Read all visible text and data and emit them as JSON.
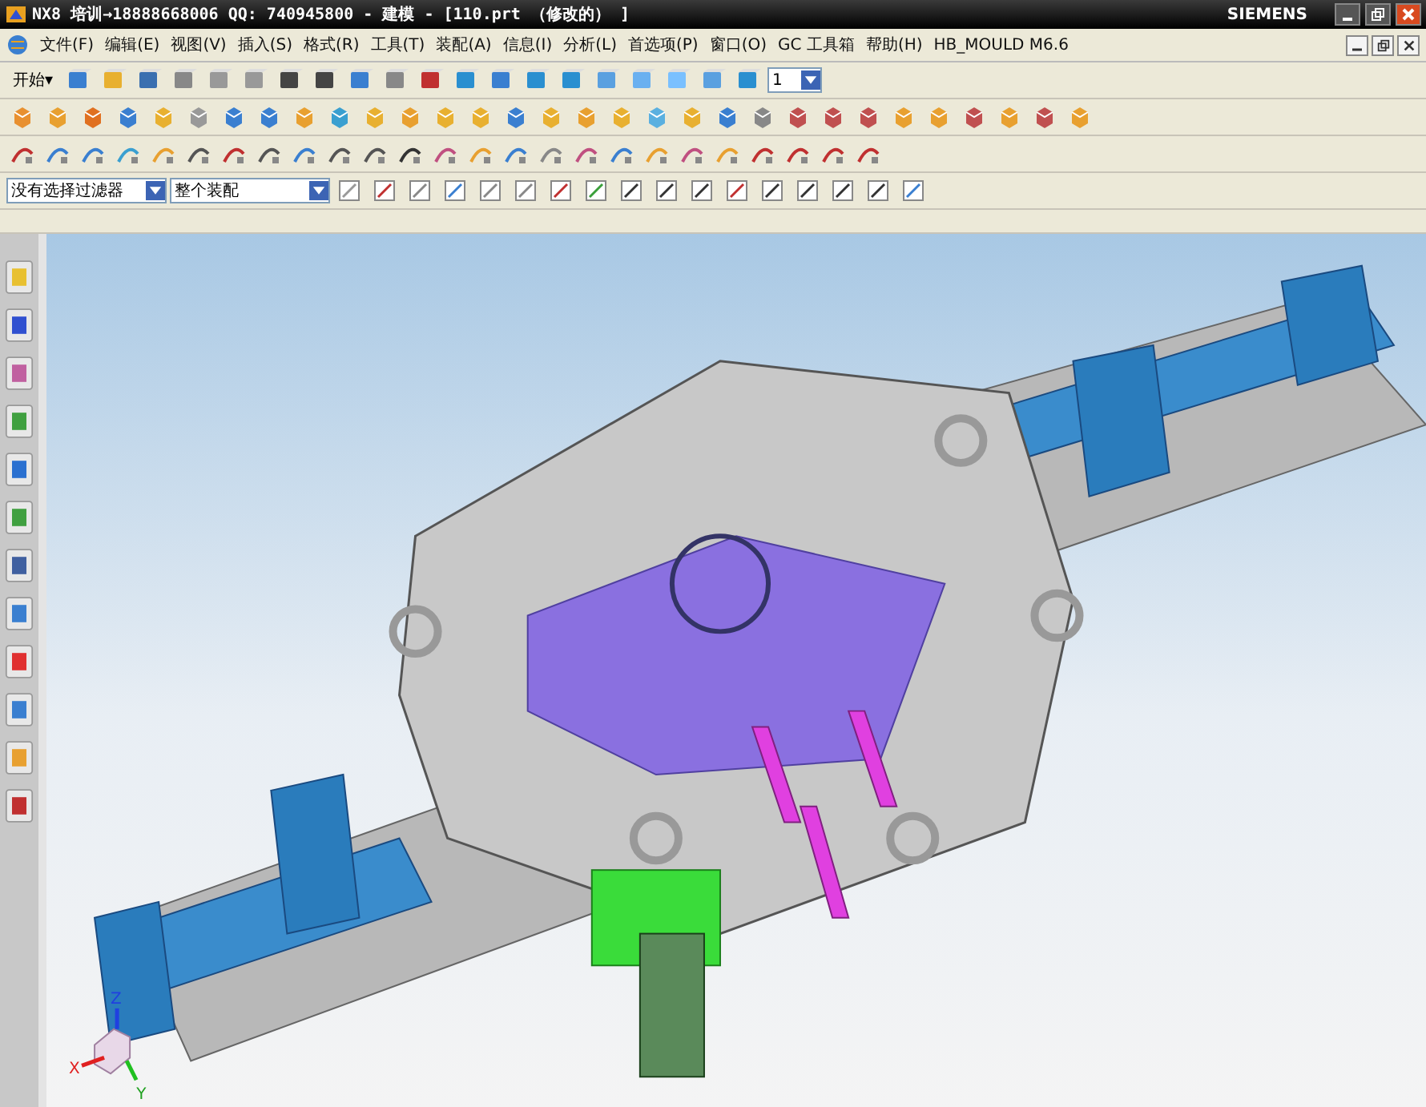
{
  "window": {
    "title": "NX8 培训→18888668006 QQ: 740945800 - 建模 - [110.prt （修改的） ]",
    "brand": "SIEMENS"
  },
  "menu_bar": {
    "start_button": "开始▾",
    "items": [
      "文件(F)",
      "编辑(E)",
      "视图(V)",
      "插入(S)",
      "格式(R)",
      "工具(T)",
      "装配(A)",
      "信息(I)",
      "分析(L)",
      "首选项(P)",
      "窗口(O)",
      "GC 工具箱",
      "帮助(H)",
      "HB_MOULD M6.6"
    ]
  },
  "selection_bar": {
    "filter": "没有选择过滤器",
    "scope": "整个装配",
    "layer": "1"
  },
  "viewport": {
    "axis_labels": [
      "X",
      "Y",
      "Z"
    ]
  }
}
